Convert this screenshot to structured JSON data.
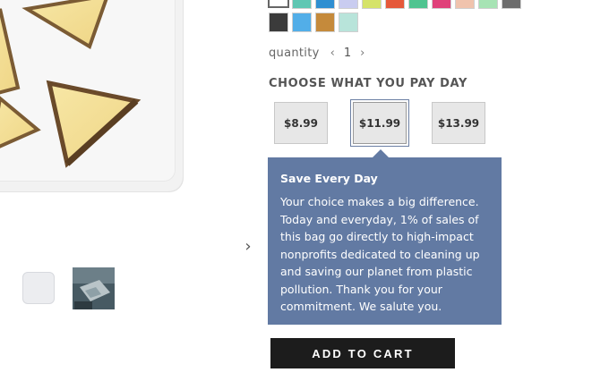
{
  "gallery": {
    "next_icon": "chevron-right-icon",
    "thumbnails": [
      {
        "name": "white bag thumbnail"
      },
      {
        "name": "lifestyle photo thumbnail"
      }
    ]
  },
  "colors": {
    "swatches_row1": [
      "#ffffff",
      "#5fc7b3",
      "#2f8fd1",
      "#c9ccf0",
      "#d5e36a",
      "#e5583a",
      "#4fc490",
      "#e0417a",
      "#f0c3ad",
      "#a7e3b4",
      "#6d6d6d"
    ],
    "swatches_row2": [
      "#3b3b3b",
      "#52aee8",
      "#c58a3b",
      "#b8e4da"
    ],
    "tooltip_bg": "#627aa3",
    "cart_bg": "#1c1c1c",
    "selected_ring": "#6b7fa3"
  },
  "quantity": {
    "label": "quantity",
    "decrement_icon": "chevron-left-icon",
    "increment_icon": "chevron-right-icon",
    "value": "1"
  },
  "pricing": {
    "heading": "CHOOSE WHAT YOU PAY DAY",
    "options": [
      "$8.99",
      "$11.99",
      "$13.99"
    ],
    "selected": "$11.99"
  },
  "tooltip": {
    "title": "Save Every Day",
    "body": "Your choice makes a big difference. Today and everyday, 1% of sales of this bag go directly to high-impact nonprofits dedicated to cleaning up and saving our planet from plastic pollution. Thank you for your commitment. We salute you."
  },
  "cart": {
    "button_label": "ADD TO CART"
  }
}
